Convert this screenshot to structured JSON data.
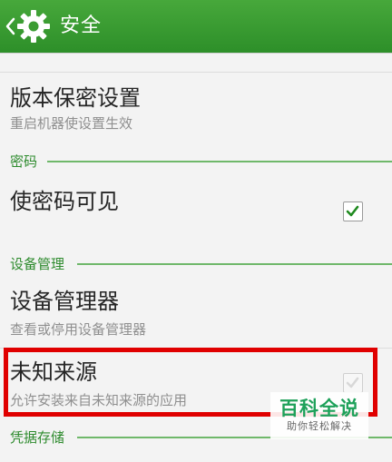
{
  "header": {
    "title": "安全",
    "back_icon": "chevron-left-icon",
    "app_icon": "gear-icon",
    "color": "#3a9c32"
  },
  "items": [
    {
      "title": "版本保密设置",
      "subtitle": "重启机器使设置生效"
    },
    {
      "title": "使密码可见",
      "checked": true
    },
    {
      "title": "设备管理器",
      "subtitle": "查看或停用设备管理器"
    },
    {
      "title": "未知来源",
      "subtitle": "允许安装来自未知来源的应用",
      "checked": false,
      "highlighted": true
    }
  ],
  "sections": [
    {
      "label": "密码"
    },
    {
      "label": "设备管理"
    },
    {
      "label": "凭据存储"
    }
  ],
  "watermark": {
    "main": "百科全说",
    "sub": "助你轻松解决"
  },
  "colors": {
    "accent": "#2e8b2e",
    "highlight": "#e00000",
    "check": "#1f8a1f"
  }
}
